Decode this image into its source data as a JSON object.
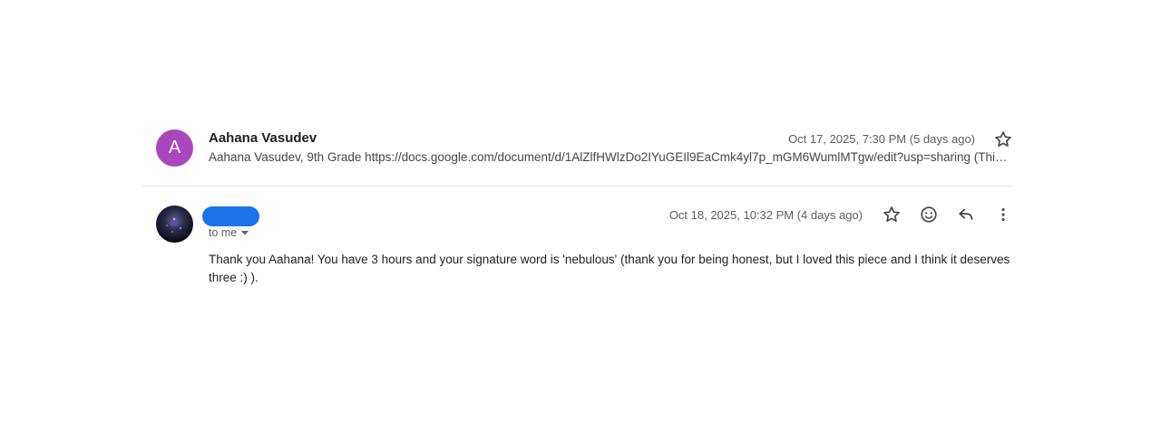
{
  "messages": [
    {
      "avatar_letter": "A",
      "avatar_color": "#ab47bc",
      "sender": "Aahana Vasudev",
      "date": "Oct 17, 2025, 7:30 PM (5 days ago)",
      "snippet": "Aahana Vasudev, 9th Grade https://docs.google.com/document/d/1AlZlfHWlzDo2IYuGEIl9EaCmk4yl7p_mGM6WumlMTgw/edit?usp=sharing (This t...",
      "star_icon": "star-outline-icon"
    },
    {
      "sender": "",
      "sender_redacted_color": "#1a73e8",
      "to_label": "to me",
      "date": "Oct 18, 2025, 10:32 PM (4 days ago)",
      "body": "Thank you Aahana! You have 3 hours and your signature word is 'nebulous' (thank you for being honest, but I loved this piece and I think it deserves three :) ).",
      "icons": [
        "star-outline-icon",
        "emoji-icon",
        "reply-icon",
        "more-vert-icon"
      ]
    }
  ]
}
